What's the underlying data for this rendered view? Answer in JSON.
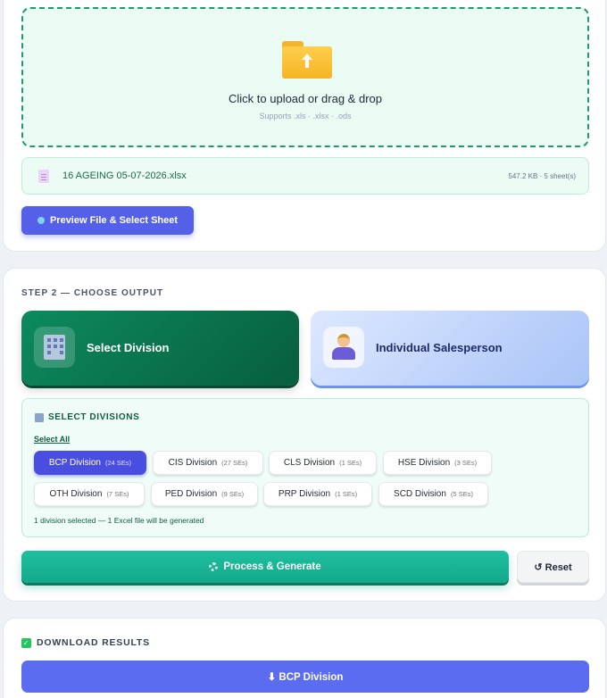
{
  "upload": {
    "title": "Click to upload or drag & drop",
    "supported": "Supports .xls · .xlsx · .ods"
  },
  "file": {
    "name": "16 AGEING 05-07-2026.xlsx",
    "meta": "547.2 KB · 5 sheet(s)"
  },
  "preview_button": "Preview File & Select Sheet",
  "step2": {
    "title": "STEP 2 — CHOOSE OUTPUT",
    "options": [
      {
        "label": "Select Division",
        "icon": "office-building-icon",
        "selected": true
      },
      {
        "label": "Individual Salesperson",
        "icon": "salesperson-icon",
        "selected": false
      }
    ]
  },
  "divisions": {
    "title": "SELECT DIVISIONS",
    "select_all": "Select All",
    "chips": [
      {
        "name": "BCP Division",
        "count": "(24 SEs)",
        "selected": true
      },
      {
        "name": "CIS Division",
        "count": "(27 SEs)",
        "selected": false
      },
      {
        "name": "CLS Division",
        "count": "(1 SEs)",
        "selected": false
      },
      {
        "name": "HSE Division",
        "count": "(3 SEs)",
        "selected": false
      },
      {
        "name": "OTH Division",
        "count": "(7 SEs)",
        "selected": false
      },
      {
        "name": "PED Division",
        "count": "(9 SEs)",
        "selected": false
      },
      {
        "name": "PRP Division",
        "count": "(1 SEs)",
        "selected": false
      },
      {
        "name": "SCD Division",
        "count": "(5 SEs)",
        "selected": false
      }
    ],
    "status": "1 division selected — 1 Excel file will be generated"
  },
  "actions": {
    "process": "Process & Generate",
    "reset": "↺ Reset"
  },
  "download": {
    "title": "DOWNLOAD RESULTS",
    "button": "⬇ BCP Division"
  },
  "colors": {
    "primary": "#5560e8",
    "success": "#0d8a5e",
    "teal": "#13a88a",
    "selected_chip": "#4a4ee0"
  }
}
